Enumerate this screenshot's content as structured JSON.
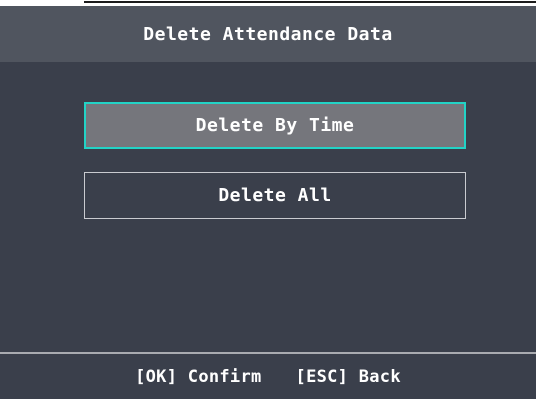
{
  "dialog": {
    "title": "Delete Attendance Data"
  },
  "menu": {
    "items": [
      {
        "label": "Delete By Time",
        "selected": true
      },
      {
        "label": "Delete All",
        "selected": false
      }
    ]
  },
  "footer": {
    "ok_hint": "[OK] Confirm",
    "esc_hint": "[ESC] Back"
  },
  "colors": {
    "panel_background": "#3a3f4b",
    "title_bar": "#50555f",
    "selected_item_fill": "#75767c",
    "selected_item_border": "#22d3c6",
    "normal_item_border": "#c9cbd0",
    "text": "#ffffff"
  }
}
